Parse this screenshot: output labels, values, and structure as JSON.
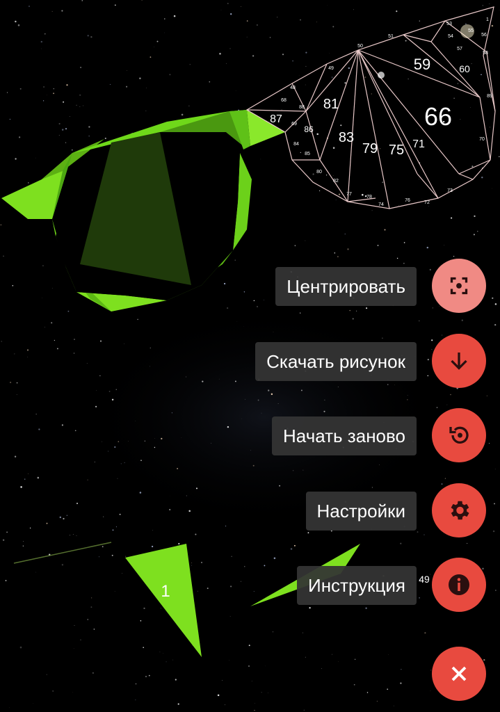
{
  "colors": {
    "background": "#000000",
    "green": "#6fd81a",
    "dark_green": "#2d4a0e",
    "outline": "#e8c8c8",
    "fab_red": "#e84a3f",
    "fab_light": "#f08a84",
    "label_bg": "#343434"
  },
  "puzzle": {
    "outline_numbers": [
      "87",
      "48",
      "49",
      "50",
      "51",
      "53",
      "55",
      "56",
      "57",
      "59",
      "60",
      "66",
      "81",
      "86",
      "83",
      "79",
      "75",
      "71",
      "85",
      "84",
      "82",
      "80",
      "77",
      "78",
      "74",
      "76",
      "72",
      "73",
      "70",
      "1",
      "54",
      "58",
      "68",
      "69",
      "88",
      "89"
    ],
    "large_numbers": [
      "66",
      "59",
      "60",
      "81",
      "83",
      "79",
      "75",
      "71",
      "87",
      "86"
    ],
    "loose_piece_number": "1",
    "loose_piece_number_2": "49"
  },
  "menu": {
    "items": [
      {
        "label": "Центрировать",
        "icon": "center-focus-icon"
      },
      {
        "label": "Скачать рисунок",
        "icon": "download-icon"
      },
      {
        "label": "Начать заново",
        "icon": "restart-icon"
      },
      {
        "label": "Настройки",
        "icon": "gear-icon"
      },
      {
        "label": "Инструкция",
        "icon": "info-icon"
      }
    ],
    "close_icon": "close-icon"
  }
}
